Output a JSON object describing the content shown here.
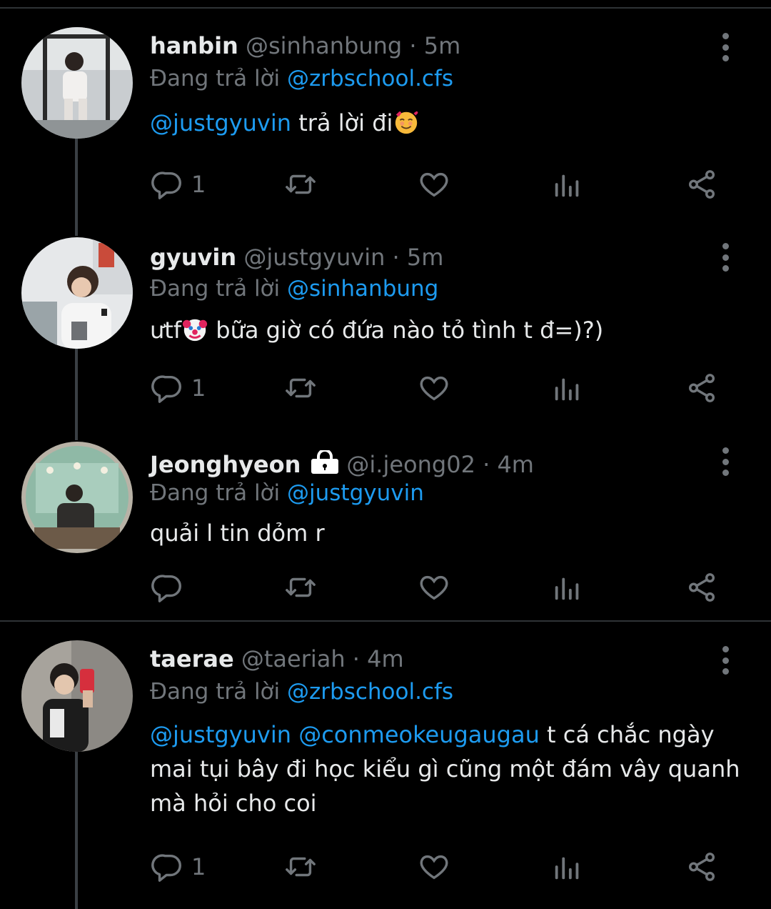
{
  "tweets": [
    {
      "name": "hanbin",
      "handle": "@sinhanbung",
      "dot": "·",
      "time": "5m",
      "replying_label": "Đang trả lời",
      "replying_to": "@zrbschool.cfs",
      "body_mention": "@justgyuvin",
      "body_text": " trả lời đi",
      "emoji": "smiling-face-with-hearts",
      "reply_count": "1",
      "locked": false
    },
    {
      "name": "gyuvin",
      "handle": "@justgyuvin",
      "dot": "·",
      "time": "5m",
      "replying_label": "Đang trả lời",
      "replying_to": "@sinhanbung",
      "body_pre": "ưtf",
      "emoji": "clown-face",
      "body_text": " bữa giờ có đứa nào tỏ tình t đ=)?)",
      "reply_count": "1",
      "locked": false
    },
    {
      "name": "Jeonghyeon",
      "handle": "@i.jeong02",
      "dot": "·",
      "time": "4m",
      "replying_label": "Đang trả lời",
      "replying_to": "@justgyuvin",
      "body_text": "quải l tin dỏm r",
      "reply_count": "",
      "locked": true
    },
    {
      "name": "taerae",
      "handle": "@taeriah",
      "dot": "·",
      "time": "4m",
      "replying_label": "Đang trả lời",
      "replying_to": "@zrbschool.cfs",
      "body_mention_1": "@justgyuvin",
      "body_mention_2": "@conmeokeugaugau",
      "body_text": " t cá chắc ngày mai tụi bây đi học kiểu gì cũng một đám vây quanh mà hỏi cho coi",
      "reply_count": "1",
      "locked": false
    }
  ],
  "icons": {
    "reply": "reply-icon",
    "retweet": "retweet-icon",
    "like": "heart-icon",
    "views": "views-icon",
    "share": "share-icon",
    "more": "more-vertical-icon",
    "lock": "lock-icon"
  },
  "colors": {
    "background": "#000000",
    "text": "#e7e9ea",
    "muted": "#71767b",
    "link": "#1d9bf0"
  }
}
